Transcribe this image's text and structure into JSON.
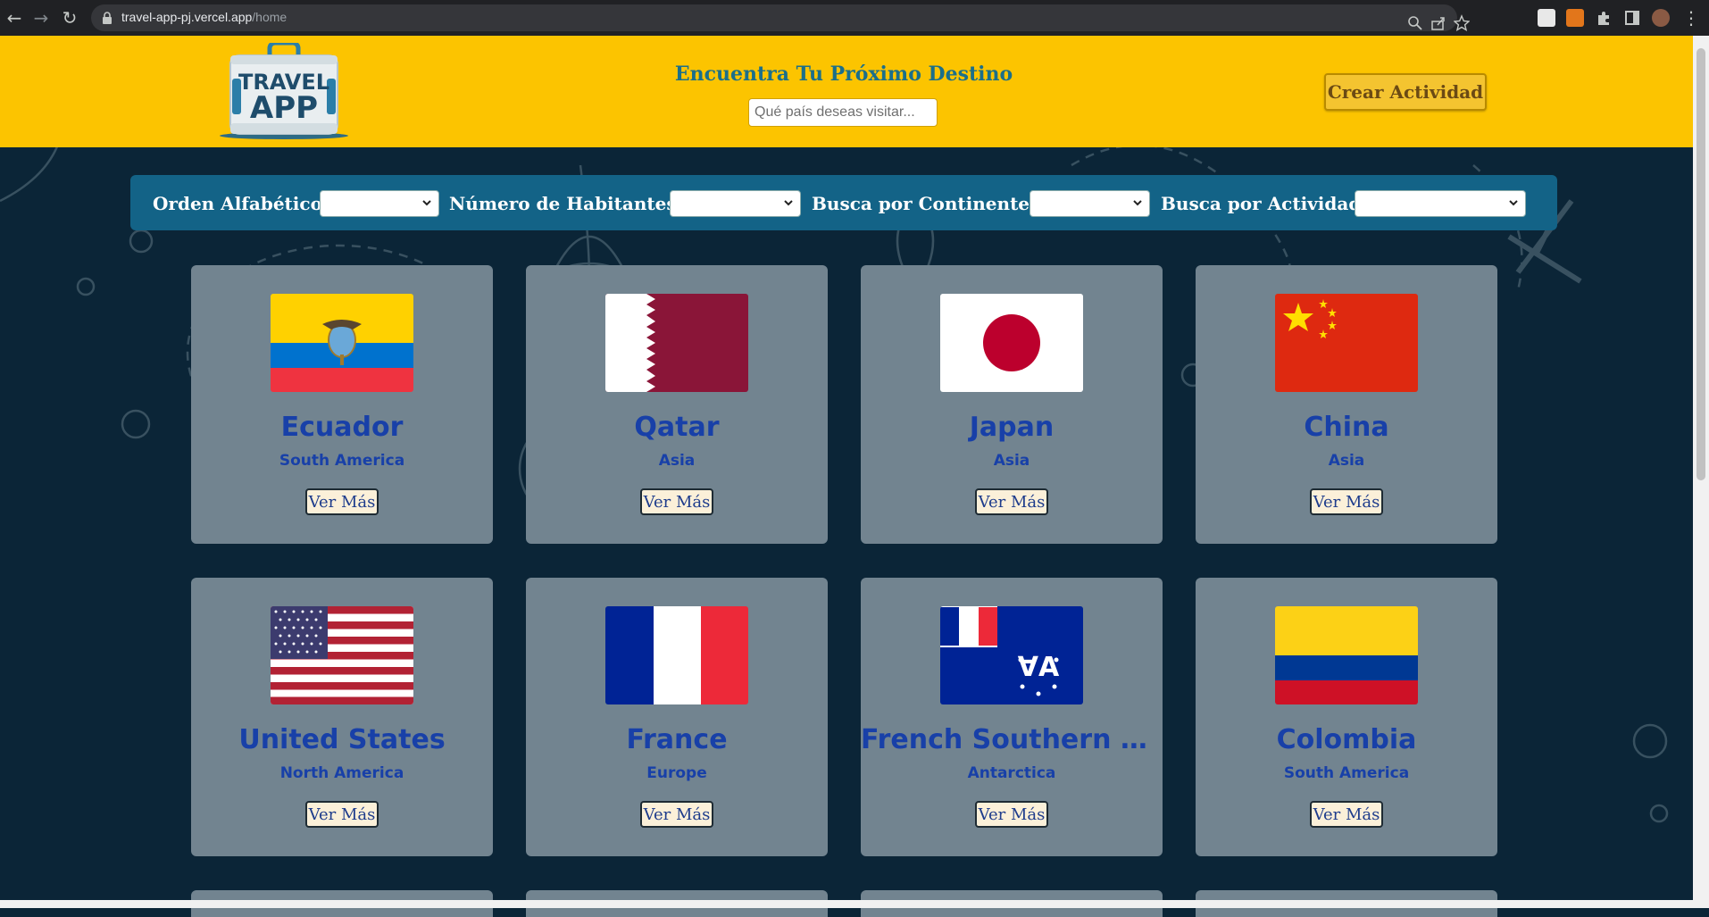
{
  "browser": {
    "url_host": "travel-app-pj.vercel.app",
    "url_path": "/home"
  },
  "header": {
    "logo_line1": "TRAVEL",
    "logo_line2": "APP",
    "title": "Encuentra Tu Próximo Destino",
    "search_placeholder": "Qué país deseas visitar...",
    "search_value": "",
    "create_button": "Crear Actividad"
  },
  "filters": [
    {
      "label": "Orden Alfabético",
      "selected": ""
    },
    {
      "label": "Número de Habitantes",
      "selected": ""
    },
    {
      "label": "Busca por Continentes",
      "selected": ""
    },
    {
      "label": "Busca por Actividad",
      "selected": ""
    }
  ],
  "countries": [
    {
      "name": "Ecuador",
      "continent": "South America",
      "button": "Ver Más",
      "flag": "ecuador-flag"
    },
    {
      "name": "Qatar",
      "continent": "Asia",
      "button": "Ver Más",
      "flag": "qatar-flag"
    },
    {
      "name": "Japan",
      "continent": "Asia",
      "button": "Ver Más",
      "flag": "japan-flag"
    },
    {
      "name": "China",
      "continent": "Asia",
      "button": "Ver Más",
      "flag": "china-flag"
    },
    {
      "name": "United States",
      "continent": "North America",
      "button": "Ver Más",
      "flag": "united-states-flag"
    },
    {
      "name": "France",
      "continent": "Europe",
      "button": "Ver Más",
      "flag": "france-flag"
    },
    {
      "name": "French Southern and ...",
      "continent": "Antarctica",
      "button": "Ver Más",
      "flag": "french-southern-territories-flag"
    },
    {
      "name": "Colombia",
      "continent": "South America",
      "button": "Ver Más",
      "flag": "colombia-flag"
    }
  ],
  "colors": {
    "header_bg": "#fcc400",
    "page_bg": "#0b2537",
    "filter_bar": "#136387",
    "card_bg": "#728490",
    "card_text": "#1840a8"
  }
}
